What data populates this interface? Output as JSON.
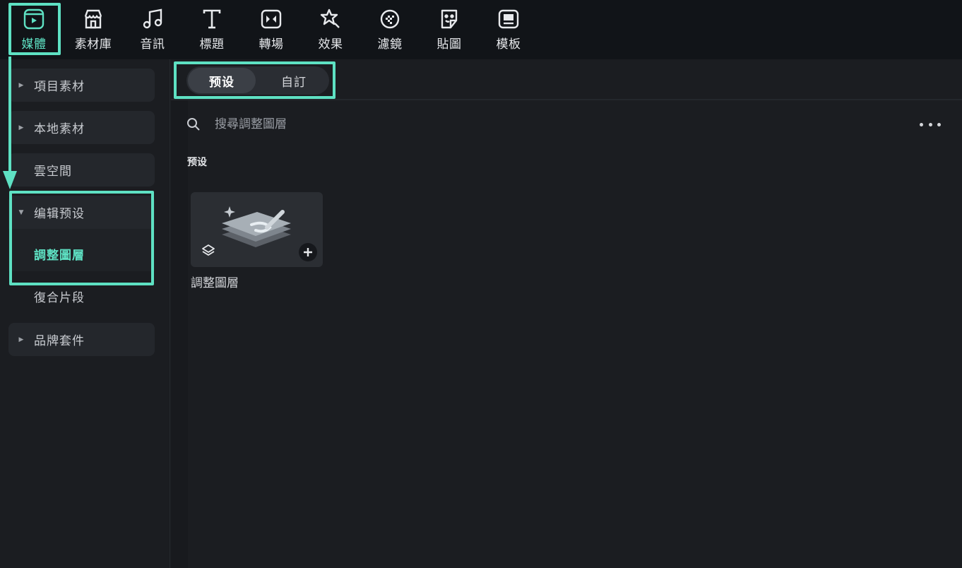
{
  "toolbar": {
    "items": [
      {
        "label": "媒體",
        "icon": "media-icon"
      },
      {
        "label": "素材庫",
        "icon": "store-icon"
      },
      {
        "label": "音訊",
        "icon": "music-note-icon"
      },
      {
        "label": "標題",
        "icon": "text-t-icon"
      },
      {
        "label": "轉場",
        "icon": "transition-icon"
      },
      {
        "label": "效果",
        "icon": "effects-star-icon"
      },
      {
        "label": "濾鏡",
        "icon": "filter-icon"
      },
      {
        "label": "貼圖",
        "icon": "sticker-icon"
      },
      {
        "label": "模板",
        "icon": "template-icon"
      }
    ],
    "active_index": 0
  },
  "sidebar": {
    "items": [
      {
        "label": "項目素材"
      },
      {
        "label": "本地素材"
      },
      {
        "label": "雲空間"
      },
      {
        "label": "编辑预设"
      },
      {
        "label": "調整圖層"
      },
      {
        "label": "復合片段"
      },
      {
        "label": "品牌套件"
      }
    ]
  },
  "tabs": {
    "items": [
      {
        "label": "预设"
      },
      {
        "label": "自訂"
      }
    ],
    "active_index": 0
  },
  "search": {
    "placeholder": "搜尋調整圖層"
  },
  "section": {
    "title": "预设"
  },
  "cards": [
    {
      "name": "調整圖層"
    }
  ],
  "colors": {
    "accent": "#5ee1c3",
    "toolbar_bg": "#111418",
    "panel_bg": "#1b1d21"
  }
}
